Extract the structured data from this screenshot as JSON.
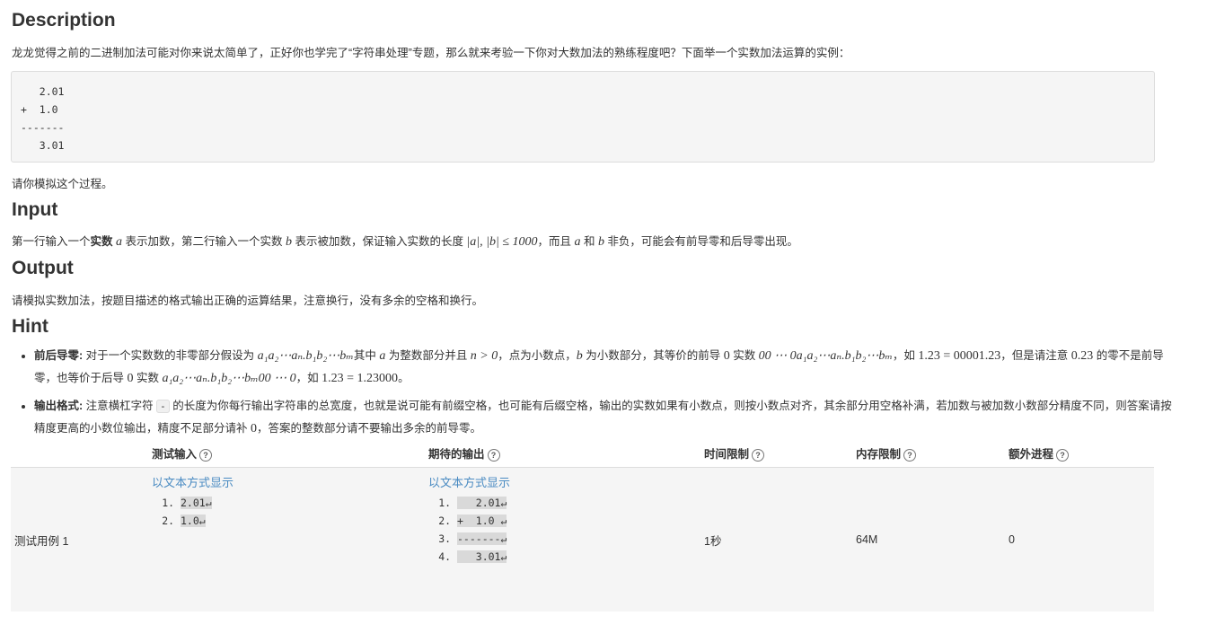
{
  "description": {
    "heading": "Description",
    "text": "龙龙觉得之前的二进制加法可能对你来说太简单了，正好你也学完了“字符串处理”专题，那么就来考验一下你对大数加法的熟练程度吧？下面举一个实数加法运算的实例：",
    "example_lines": [
      "   2.01",
      "+  1.0",
      "-------",
      "   3.01"
    ],
    "after": "请你模拟这个过程。"
  },
  "input": {
    "heading": "Input",
    "parts": {
      "p1": "第一行输入一个",
      "bold": "实数",
      "a": "a",
      "p2": " 表示加数，第二行输入一个实数 ",
      "b": "b",
      "p3": " 表示被加数，保证输入实数的长度 ",
      "cond": "|a|, |b| ≤ 1000",
      "p4": "，而且 ",
      "a2": "a",
      "p5": " 和 ",
      "b2": "b",
      "p6": " 非负，可能会有前导零和后导零出现。"
    }
  },
  "output": {
    "heading": "Output",
    "text": "请模拟实数加法，按题目描述的格式输出正确的运算结果，注意换行，没有多余的空格和换行。"
  },
  "hint": {
    "heading": "Hint",
    "item1": {
      "label": "前后导零:",
      "t1": " 对于一个实数数的非零部分假设为 ",
      "f1": "a₁a₂⋯aₙ.b₁b₂⋯bₘ",
      "t2": "其中 ",
      "a": "a",
      "t3": " 为整数部分并且 ",
      "n": "n > 0",
      "t4": "，点为小数点，",
      "b": "b",
      "t5": " 为小数部分，其等价的前导 ",
      "zero": "0",
      "t6": " 实数 ",
      "f2": "00 ⋯ 0a₁a₂⋯aₙ.b₁b₂⋯bₘ",
      "t7": "，如 ",
      "eq1": "1.23 = 00001.23",
      "t8": "，但是请注意 ",
      "n023": "0.23",
      "t9": " 的零不是前导零，也等价于后导 ",
      "zero2": "0",
      "t10": " 实数 ",
      "f3": "a₁a₂⋯aₙ.b₁b₂⋯bₘ00 ⋯ 0",
      "t11": "，如 ",
      "eq2": "1.23 = 1.23000",
      "t12": "。"
    },
    "item2": {
      "label": "输出格式:",
      "t1": " 注意横杠字符 ",
      "code": "-",
      "t2": " 的长度为你每行输出字符串的总宽度，也就是说可能有前缀空格，也可能有后缀空格，输出的实数如果有小数点，则按小数点对齐，其余部分用空格补满，若加数与被加数小数部分精度不同，则答案请按精度更高的小数位输出，精度不足部分请补 ",
      "zero": "0",
      "t3": "，答案的整数部分请不要输出多余的前导零。"
    }
  },
  "tests": {
    "headers": {
      "input": "测试输入",
      "expected": "期待的输出",
      "time": "时间限制",
      "memory": "内存限制",
      "procs": "额外进程"
    },
    "help_icon": "question-icon",
    "rows": [
      {
        "name": "测试用例 1",
        "show_text": "以文本方式显示",
        "input_lines": [
          "2.01↵",
          "1.0↵"
        ],
        "output_lines": [
          "   2.01↵",
          "+  1.0 ↵",
          "-------↵",
          "   3.01↵"
        ],
        "time": "1秒",
        "memory": "64M",
        "procs": "0"
      }
    ]
  }
}
